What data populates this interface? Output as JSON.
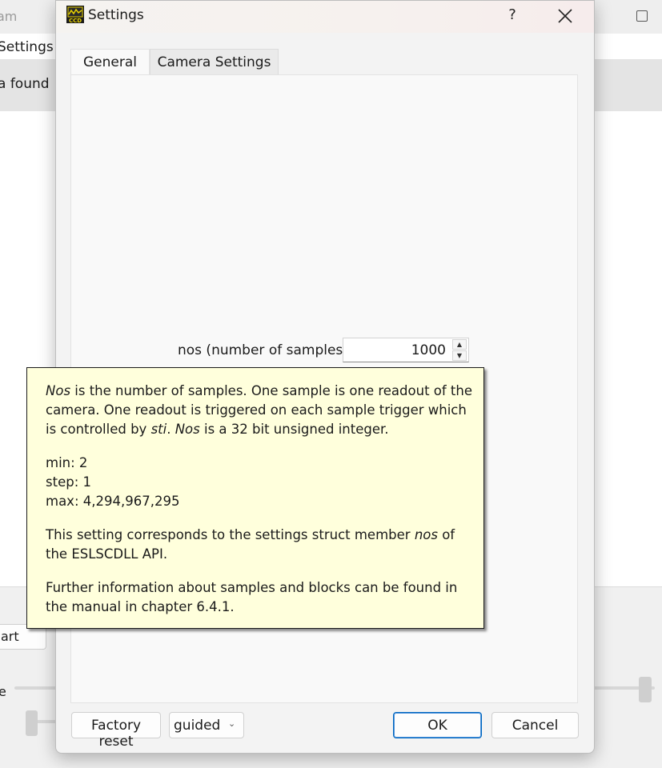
{
  "background_app": {
    "title_fragment": "am",
    "menu_fragment": "Settings",
    "info_fragment": "a found",
    "start_button_fragment": "art",
    "slider_label_fragment": "e"
  },
  "dialog": {
    "title": "Settings",
    "help_label": "?",
    "icon": "ccd-camera-icon",
    "tabs": [
      {
        "label": "General",
        "active": true
      },
      {
        "label": "Camera Settings",
        "active": false
      }
    ],
    "field": {
      "label": "nos (number of samples)",
      "value": "1000"
    },
    "buttons": {
      "factory_reset": "Factory reset",
      "mode_select": "guided",
      "ok": "OK",
      "cancel": "Cancel"
    }
  },
  "tooltip": {
    "p1": {
      "t1": "Nos",
      "t2": " is the number of samples. One sample is one readout of the camera. One readout is triggered on each sample trigger which is controlled by ",
      "t3": "sti",
      "t4": ". ",
      "t5": "Nos",
      "t6": " is a 32 bit unsigned integer."
    },
    "min": "min: 2",
    "step": "step: 1",
    "max": "max: 4,294,967,295",
    "p3": {
      "t1": "This setting corresponds to the settings struct member ",
      "t2": "nos",
      "t3": " of the ESLSCDLL API."
    },
    "p4": "Further information about samples and blocks can be found in the manual in chapter 6.4.1."
  }
}
